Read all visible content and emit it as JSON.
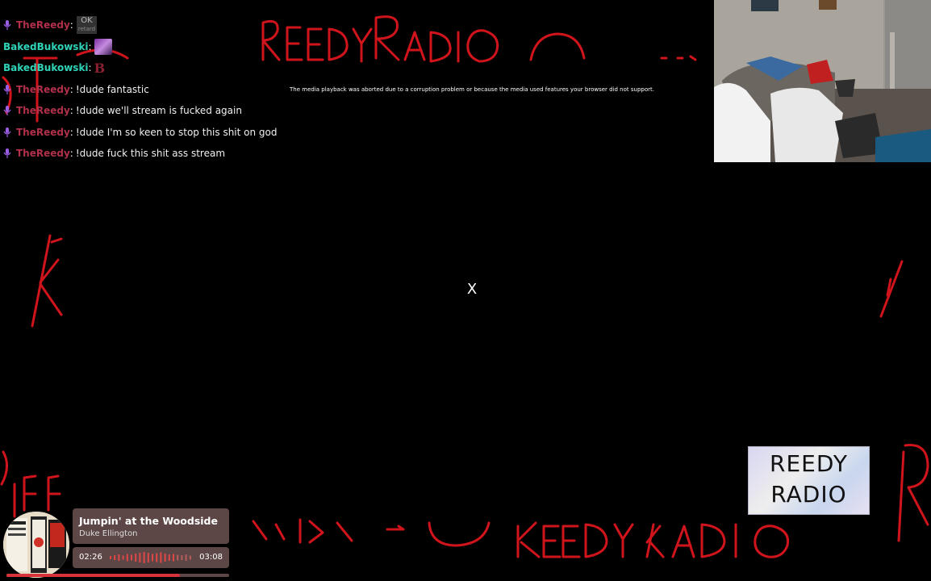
{
  "overlay": {
    "title_top": "REEDY RADIO",
    "title_bottom": "REEDY RADIO",
    "accent_color": "#d0141c"
  },
  "chat": {
    "messages": [
      {
        "user": "TheReedy",
        "text": "",
        "emote": "OK",
        "emote_sub": "retard"
      },
      {
        "user": "BakedBukowski",
        "text": "",
        "emote": "image"
      },
      {
        "user": "BakedBukowski",
        "text": "",
        "emote": "B"
      },
      {
        "user": "TheReedy",
        "text": "!dude fantastic"
      },
      {
        "user": "TheReedy",
        "text": "!dude we'll stream is fucked again"
      },
      {
        "user": "TheReedy",
        "text": "!dude I'm so keen to stop this shit on god"
      },
      {
        "user": "TheReedy",
        "text": "!dude fuck this shit ass stream"
      }
    ]
  },
  "media": {
    "error_text": "The media playback was aborted due to a corruption problem or because the media used features your browser did not support.",
    "close_label": "X"
  },
  "logo": {
    "line1": "REEDY",
    "line2": "RADIO"
  },
  "now_playing": {
    "title": "Jumpin' at the Woodside",
    "artist": "Duke Ellington",
    "current_time": "02:26",
    "duration": "03:08",
    "progress_fraction": 0.78
  }
}
